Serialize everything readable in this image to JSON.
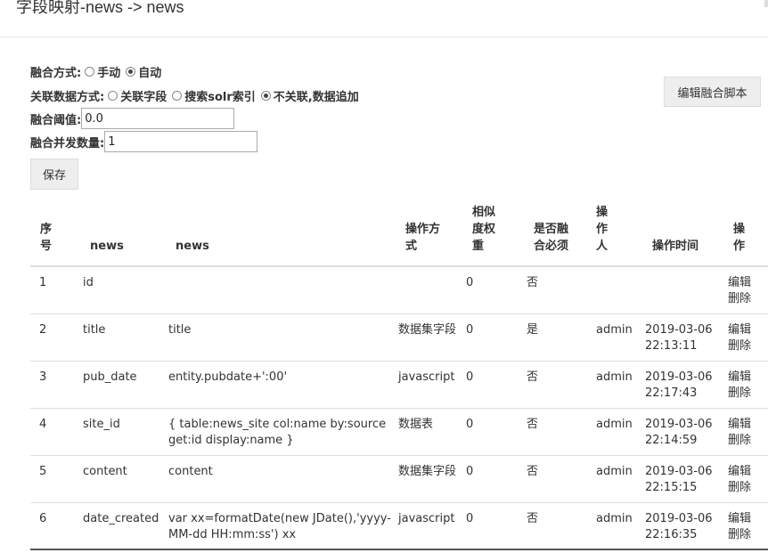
{
  "page_title": "字段映射-news -> news",
  "form": {
    "merge_mode": {
      "label": "融合方式:",
      "options": [
        {
          "label": "手动",
          "checked": false
        },
        {
          "label": "自动",
          "checked": true
        }
      ]
    },
    "relation_mode": {
      "label": "关联数据方式:",
      "options": [
        {
          "label": "关联字段",
          "checked": false
        },
        {
          "label": "搜索solr索引",
          "checked": false
        },
        {
          "label": "不关联,数据追加",
          "checked": true
        }
      ]
    },
    "threshold": {
      "label": "融合阈值:",
      "value": "0.0"
    },
    "concurrency": {
      "label": "融合并发数量:",
      "value": "1"
    },
    "save_label": "保存",
    "edit_script_label": "编辑融合脚本"
  },
  "table": {
    "headers": {
      "seq": [
        "序",
        "号"
      ],
      "src": "news",
      "dst": "news",
      "op_mode": [
        "操作方",
        "式"
      ],
      "weight": [
        "相似",
        "度权",
        "重"
      ],
      "required": [
        "是否融",
        "合必须"
      ],
      "operator": [
        "操",
        "作",
        "人"
      ],
      "op_time": "操作时间",
      "ops": [
        "操",
        "作"
      ]
    },
    "rows": [
      {
        "seq": "1",
        "src": "id",
        "dst": "",
        "mode": "",
        "weight": "0",
        "required": "否",
        "operator": "",
        "time": "",
        "edit": "编辑",
        "del": "删除"
      },
      {
        "seq": "2",
        "src": "title",
        "dst": "title",
        "mode": "数据集字段",
        "weight": "0",
        "required": "是",
        "operator": "admin",
        "time": "2019-03-06 22:13:11",
        "edit": "编辑",
        "del": "删除"
      },
      {
        "seq": "3",
        "src": "pub_date",
        "dst": "entity.pubdate+':00'",
        "mode": "javascript",
        "weight": "0",
        "required": "否",
        "operator": "admin",
        "time": "2019-03-06 22:17:43",
        "edit": "编辑",
        "del": "删除"
      },
      {
        "seq": "4",
        "src": "site_id",
        "dst": "{ table:news_site col:name by:source get:id display:name }",
        "mode": "数据表",
        "weight": "0",
        "required": "否",
        "operator": "admin",
        "time": "2019-03-06 22:14:59",
        "edit": "编辑",
        "del": "删除"
      },
      {
        "seq": "5",
        "src": "content",
        "dst": "content",
        "mode": "数据集字段",
        "weight": "0",
        "required": "否",
        "operator": "admin",
        "time": "2019-03-06 22:15:15",
        "edit": "编辑",
        "del": "删除"
      },
      {
        "seq": "6",
        "src": "date_created",
        "dst": "var xx=formatDate(new JDate(),'yyyy-MM-dd HH:mm:ss') xx",
        "mode": "javascript",
        "weight": "0",
        "required": "否",
        "operator": "admin",
        "time": "2019-03-06 22:16:35",
        "edit": "编辑",
        "del": "删除"
      }
    ]
  }
}
